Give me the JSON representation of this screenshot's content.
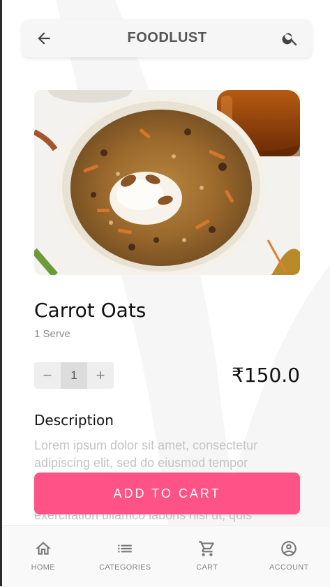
{
  "app_bar": {
    "title": "FOODLUST",
    "back_icon": "arrow-left-icon",
    "search_icon": "search-icon"
  },
  "product": {
    "name": "Carrot Oats",
    "serving": "1 Serve",
    "quantity": "1",
    "decrement_symbol": "−",
    "increment_symbol": "+",
    "price": "₹150.0",
    "image": "carrot-oats-bowl"
  },
  "description": {
    "heading": "Description",
    "text": "Lorem ipsum dolor sit amet, consectetur adipiscing elit, sed do eiusmod tempor incididunt ut labore et dolore magna aliqua. Ut enim ad minim veniam, quis nostrud exercitation ullamco laboris nisi ut, quis"
  },
  "cta": {
    "label": "ADD TO CART",
    "color": "#ff5286"
  },
  "bottom_nav": {
    "items": [
      {
        "label": "HOME",
        "icon": "home-icon"
      },
      {
        "label": "CATEGORIES",
        "icon": "list-icon"
      },
      {
        "label": "CART",
        "icon": "cart-icon"
      },
      {
        "label": "ACCOUNT",
        "icon": "account-icon"
      }
    ]
  }
}
